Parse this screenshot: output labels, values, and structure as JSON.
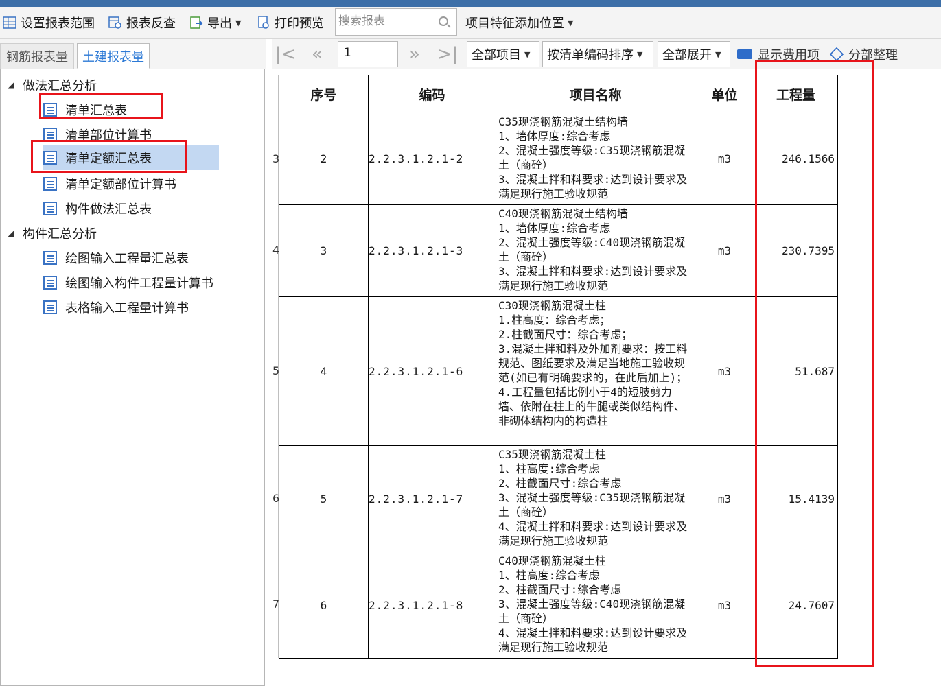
{
  "toolbar": {
    "set_range": "设置报表范围",
    "reverse_check": "报表反查",
    "export": "导出",
    "print_preview": "打印预览",
    "search_placeholder": "搜索报表",
    "feature_position": "项目特征添加位置"
  },
  "tabs": {
    "rebar": "钢筋报表量",
    "civil": "土建报表量"
  },
  "tree": {
    "group1": "做法汇总分析",
    "group1_items": [
      "清单汇总表",
      "清单部位计算书",
      "清单定额汇总表",
      "清单定额部位计算书",
      "构件做法汇总表"
    ],
    "group2": "构件汇总分析",
    "group2_items": [
      "绘图输入工程量汇总表",
      "绘图输入构件工程量计算书",
      "表格输入工程量计算书"
    ],
    "selected": "清单定额汇总表"
  },
  "report_toolbar": {
    "page": "1",
    "scope": "全部项目",
    "sort": "按清单编码排序",
    "expand": "全部展开",
    "show_fee": "显示费用项",
    "organize": "分部整理"
  },
  "table": {
    "headers": [
      "序号",
      "编码",
      "项目名称",
      "单位",
      "工程量"
    ],
    "rows": [
      {
        "marker": "3",
        "idx": "2",
        "code": "2.2.3.1.2.1-2",
        "name": [
          "C35现浇钢筋混凝土结构墙",
          "1、墙体厚度:综合考虑",
          "2、混凝土强度等级:C35现浇钢筋混凝土（商砼）",
          "3、混凝土拌和料要求:达到设计要求及满足现行施工验收规范"
        ],
        "unit": "m3",
        "qty": "246.1566"
      },
      {
        "marker": "4",
        "idx": "3",
        "code": "2.2.3.1.2.1-3",
        "name": [
          "C40现浇钢筋混凝土结构墙",
          "1、墙体厚度:综合考虑",
          "2、混凝土强度等级:C40现浇钢筋混凝土（商砼）",
          "3、混凝土拌和料要求:达到设计要求及满足现行施工验收规范"
        ],
        "unit": "m3",
        "qty": "230.7395"
      },
      {
        "marker": "5",
        "idx": "4",
        "code": "2.2.3.1.2.1-6",
        "name": [
          "C30现浇钢筋混凝土柱",
          "1.柱高度：综合考虑；",
          "2.柱截面尺寸：综合考虑；",
          "3.混凝土拌和料及外加剂要求：按工料规范、图纸要求及满足当地施工验收规范(如已有明确要求的，在此后加上)；",
          "4.工程量包括比例小于4的短肢剪力墙、依附在柱上的牛腿或类似结构件、非砌体结构内的构造柱"
        ],
        "unit": "m3",
        "qty": "51.687"
      },
      {
        "marker": "6",
        "idx": "5",
        "code": "2.2.3.1.2.1-7",
        "name": [
          "C35现浇钢筋混凝土柱",
          "1、柱高度:综合考虑",
          "2、柱截面尺寸:综合考虑",
          "3、混凝土强度等级:C35现浇钢筋混凝土（商砼）",
          "4、混凝土拌和料要求:达到设计要求及满足现行施工验收规范"
        ],
        "unit": "m3",
        "qty": "15.4139"
      },
      {
        "marker": "7",
        "idx": "6",
        "code": "2.2.3.1.2.1-8",
        "name": [
          "C40现浇钢筋混凝土柱",
          "1、柱高度:综合考虑",
          "2、柱截面尺寸:综合考虑",
          "3、混凝土强度等级:C40现浇钢筋混凝土（商砼）",
          "4、混凝土拌和料要求:达到设计要求及满足现行施工验收规范"
        ],
        "unit": "m3",
        "qty": "24.7607"
      }
    ]
  },
  "colors": {
    "accent": "#2d7ad6",
    "annotation": "#e8141b",
    "selected_bg": "#c3d8f2",
    "title_bar": "#3d6fa8"
  }
}
